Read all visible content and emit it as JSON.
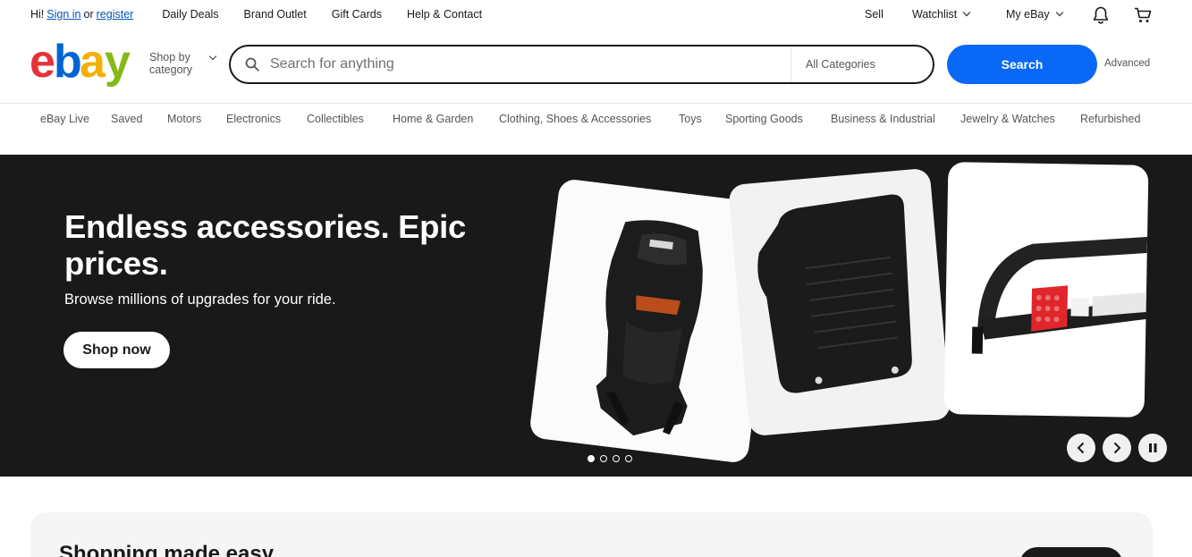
{
  "topbar": {
    "greeting": "Hi!",
    "sign_in": "Sign in",
    "or": "or",
    "register": "register",
    "links": [
      "Daily Deals",
      "Brand Outlet",
      "Gift Cards",
      "Help & Contact"
    ],
    "sell": "Sell",
    "watchlist": "Watchlist",
    "my_ebay": "My eBay"
  },
  "header": {
    "shop_by_line1": "Shop by",
    "shop_by_line2": "category",
    "search_placeholder": "Search for anything",
    "category_select": "All Categories",
    "search_button": "Search",
    "advanced": "Advanced"
  },
  "nav": {
    "items": [
      "eBay Live",
      "Saved",
      "Motors",
      "Electronics",
      "Collectibles",
      "Home & Garden",
      "Clothing, Shoes & Accessories",
      "Toys",
      "Sporting Goods",
      "Business & Industrial",
      "Jewelry & Watches",
      "Refurbished"
    ]
  },
  "hero": {
    "headline": "Endless accessories. Epic prices.",
    "subtitle": "Browse millions of upgrades for your ride.",
    "cta": "Shop now",
    "slide_count": 4,
    "active_slide": 1
  },
  "promo": {
    "heading": "Shopping made easy"
  },
  "colors": {
    "brand_red": "#e53238",
    "brand_blue": "#0064d2",
    "brand_yellow": "#f5af02",
    "brand_green": "#86b817",
    "search_blue": "#0968f6",
    "hero_bg": "#191919"
  }
}
